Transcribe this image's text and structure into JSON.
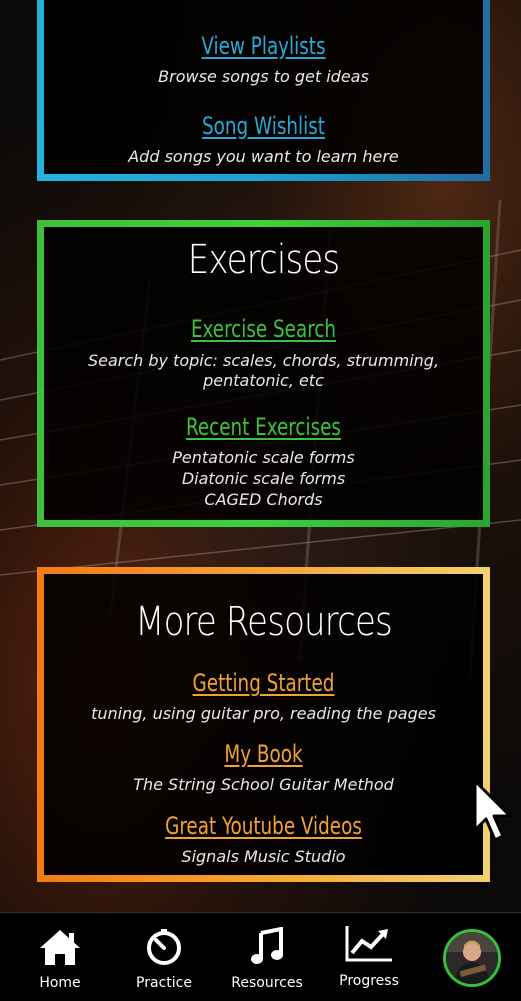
{
  "songs_panel": {
    "links": [
      {
        "label": "View Playlists",
        "desc": "Browse songs to get ideas"
      },
      {
        "label": "Song Wishlist",
        "desc": "Add songs you want to learn here"
      }
    ]
  },
  "exercises_panel": {
    "title": "Exercises",
    "search": {
      "label": "Exercise Search",
      "desc": "Search by topic: scales, chords, strumming, pentatonic, etc"
    },
    "recent": {
      "label": "Recent Exercises",
      "items": [
        "Pentatonic scale forms",
        "Diatonic scale forms",
        "CAGED Chords"
      ]
    }
  },
  "resources_panel": {
    "title": "More Resources",
    "links": [
      {
        "label": "Getting Started",
        "desc": "tuning, using guitar pro, reading the pages"
      },
      {
        "label": "My Book",
        "desc": "The String School Guitar Method"
      },
      {
        "label": "Great Youtube Videos",
        "desc": "Signals Music Studio"
      }
    ]
  },
  "tabbar": {
    "tabs": [
      {
        "label": "Home",
        "icon": "home-icon"
      },
      {
        "label": "Practice",
        "icon": "timer-icon"
      },
      {
        "label": "Resources",
        "icon": "music-note-icon"
      },
      {
        "label": "Progress",
        "icon": "chart-icon"
      }
    ],
    "avatar": "profile-avatar"
  },
  "colors": {
    "songs_accent": "#27a9d8",
    "exercises_accent": "#3fc03c",
    "resources_accent": "#f1a136"
  }
}
